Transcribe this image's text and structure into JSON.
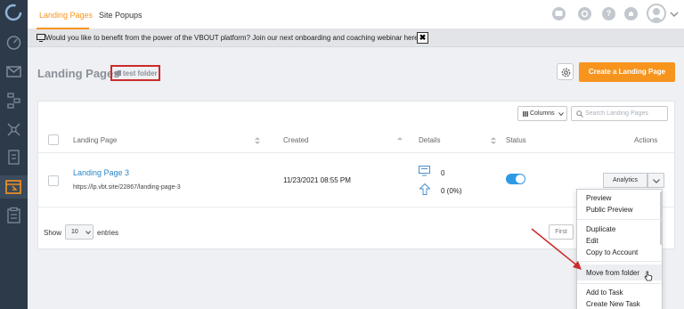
{
  "topbar": {
    "tabs": [
      {
        "label": "Landing Pages",
        "active": true
      },
      {
        "label": "Site Popups",
        "active": false
      }
    ],
    "help_icon_text": "?"
  },
  "notice": {
    "text": "Would you like to benefit from the power of the VBOUT platform? Join our next onboarding and coaching webinar here ➜",
    "close": "✖"
  },
  "header": {
    "title": "Landing Pages",
    "folder": "test folder",
    "create_button": "Create a Landing Page"
  },
  "table": {
    "columns_button": "Columns",
    "search_placeholder": "Search Landing Pages",
    "headers": {
      "landing_page": "Landing Page",
      "created": "Created",
      "details": "Details",
      "status": "Status",
      "actions": "Actions"
    },
    "rows": [
      {
        "name": "Landing Page 3",
        "url": "https://lp.vbt.site/22867/landing-page-3",
        "created": "11/23/2021 08:55 PM",
        "details_views": "0",
        "details_conversions": "0 (0%)",
        "status_on": true,
        "action": "Analytics"
      }
    ],
    "show_label": "Show",
    "entries_value": "10",
    "entries_label": "entries",
    "first_button": "First"
  },
  "dropdown": {
    "items": [
      "Preview",
      "Public Preview",
      "Duplicate",
      "Edit",
      "Copy to Account",
      "Move from folder",
      "Add to Task",
      "Create New Task"
    ]
  },
  "colors": {
    "accent": "#f7941d",
    "sidebar": "#2d3a4a",
    "link": "#2a86c7",
    "toggle": "#2d9ae6",
    "annotation": "#cc2a2a"
  }
}
